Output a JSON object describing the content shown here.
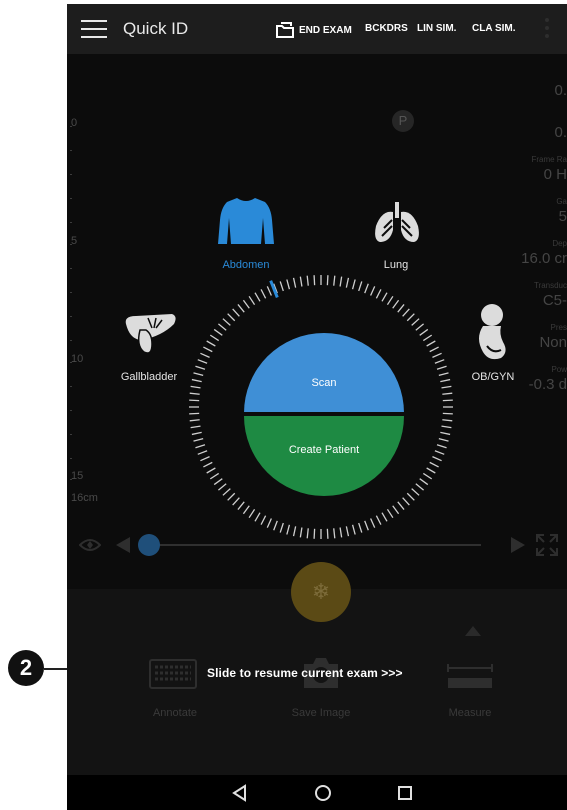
{
  "topbar": {
    "title": "Quick ID",
    "end_exam": "END EXAM",
    "bckdrs": "BCKDRS",
    "lin_sim": "LIN SIM.",
    "cla_sim": "CLA SIM."
  },
  "depth_scale": {
    "ticks": [
      "0",
      "5",
      "10",
      "15"
    ],
    "depth_label": "16cm"
  },
  "status_badge": "P",
  "right_panel": [
    {
      "label": "",
      "value": "0."
    },
    {
      "label": "",
      "value": "0."
    },
    {
      "label": "Frame Ra",
      "value": "0 H"
    },
    {
      "label": "Ga",
      "value": "5"
    },
    {
      "label": "Dep",
      "value": "16.0 cr"
    },
    {
      "label": "Transduc",
      "value": "C5-"
    },
    {
      "label": "Pres",
      "value": "Non"
    },
    {
      "label": "Pow",
      "value": "-0.3 d"
    }
  ],
  "organs": {
    "abdomen": "Abdomen",
    "lung": "Lung",
    "gallbladder": "Gallbladder",
    "obgyn": "OB/GYN"
  },
  "dial": {
    "scan": "Scan",
    "create_patient": "Create Patient"
  },
  "bottom_actions": {
    "annotate": "Annotate",
    "save_image": "Save Image",
    "measure": "Measure"
  },
  "slide_resume": "Slide to resume current exam >>>",
  "callout": "2",
  "colors": {
    "accent_blue": "#3f8fd6",
    "accent_green": "#1e8a43",
    "abdomen_icon": "#2a8ad8",
    "freeze_gold": "#5b4a15"
  }
}
